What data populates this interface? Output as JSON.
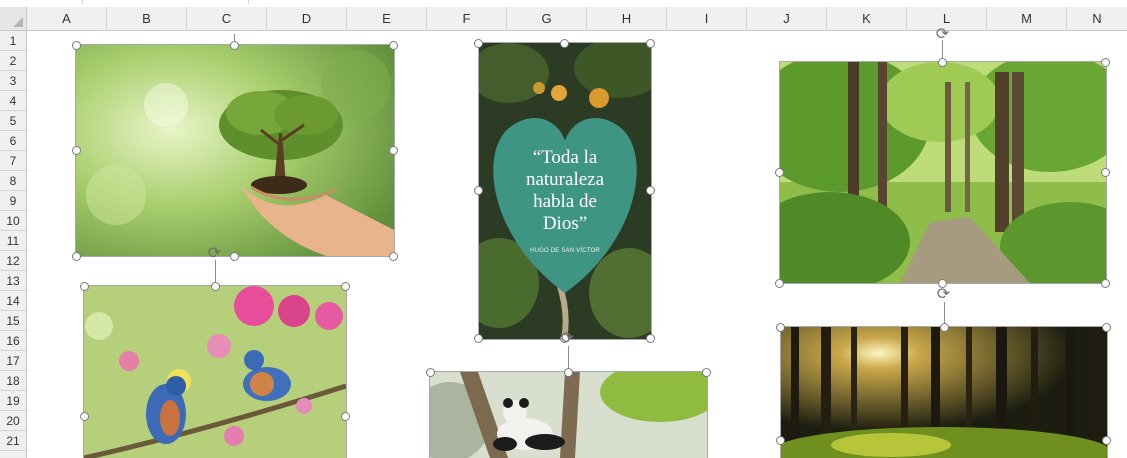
{
  "columns": [
    "A",
    "B",
    "C",
    "D",
    "E",
    "F",
    "G",
    "H",
    "I",
    "J",
    "K",
    "L",
    "M",
    "N"
  ],
  "rows": [
    "1",
    "2",
    "3",
    "4",
    "5",
    "6",
    "7",
    "8",
    "9",
    "10",
    "11",
    "12",
    "13",
    "14",
    "15",
    "16",
    "17",
    "18",
    "19",
    "20",
    "21"
  ],
  "images": {
    "hands_tree": {
      "alt": "hands-holding-tree-photo"
    },
    "quote": {
      "text": "“Toda la naturaleza habla de Dios”",
      "author": "HUGO DE SAN VÍCTOR"
    },
    "forest_path": {
      "alt": "forest-path-photo"
    },
    "bluebirds": {
      "alt": "bluebirds-on-blossom-photo"
    },
    "panda": {
      "alt": "panda-in-tree-photo"
    },
    "sunlit_forest": {
      "alt": "sunlit-forest-photo"
    }
  },
  "colors": {
    "header_bg": "#f0f0f0",
    "grid_line": "#d4d4d4",
    "handle_border": "#7a7a7a"
  }
}
